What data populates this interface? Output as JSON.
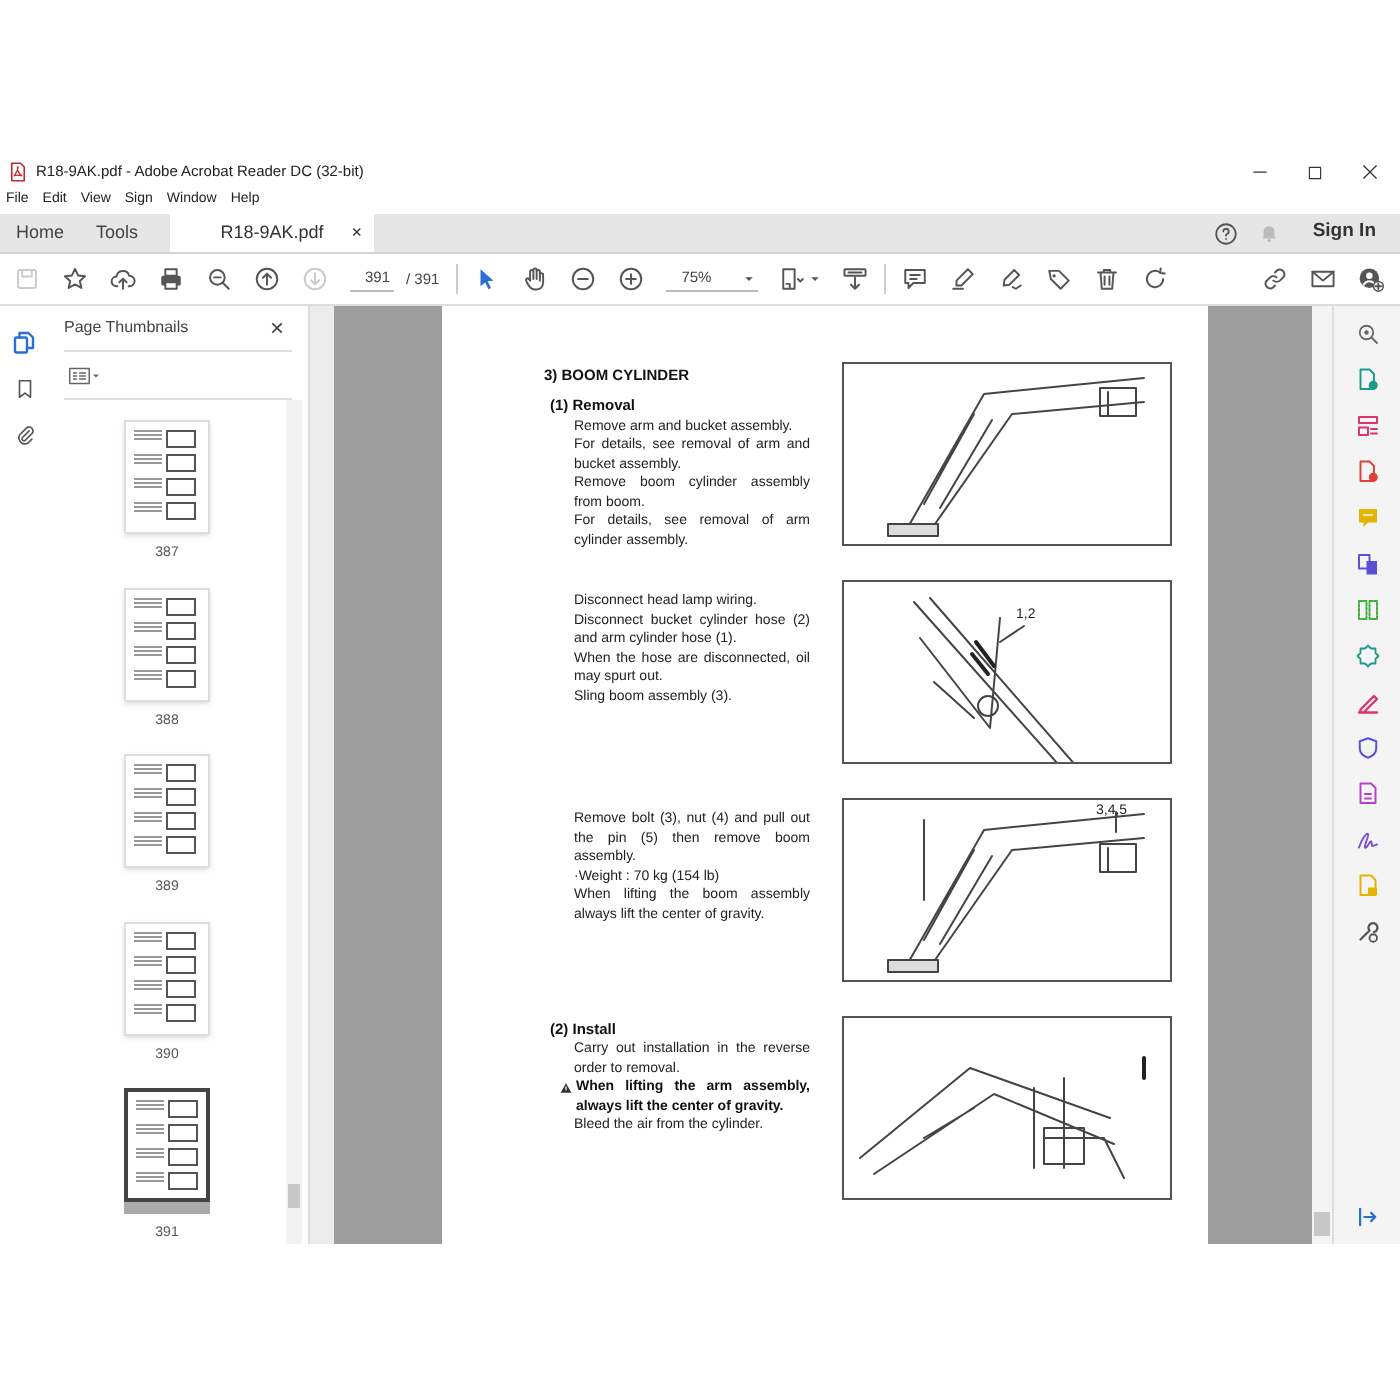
{
  "window": {
    "title": "R18-9AK.pdf - Adobe Acrobat Reader DC (32-bit)"
  },
  "menu": [
    "File",
    "Edit",
    "View",
    "Sign",
    "Window",
    "Help"
  ],
  "tabs": [
    {
      "label": "Home",
      "selected": false
    },
    {
      "label": "Tools",
      "selected": false
    },
    {
      "label": "R18-9AK.pdf",
      "selected": true,
      "close": "×"
    }
  ],
  "account": {
    "sign_in": "Sign In"
  },
  "toolbar": {
    "groups": [
      [
        {
          "kind": "save",
          "disabled": true
        },
        {
          "kind": "star",
          "disabled": false
        },
        {
          "kind": "upload",
          "disabled": false
        },
        {
          "kind": "print",
          "disabled": false
        },
        {
          "kind": "zoomglass",
          "disabled": false
        },
        {
          "kind": "up",
          "disabled": false
        },
        {
          "kind": "down",
          "disabled": true
        },
        {
          "kind": "page",
          "value": "391",
          "total": "/ 391",
          "disabled": false
        }
      ],
      [
        {
          "kind": "pointer",
          "disabled": false
        },
        {
          "kind": "hand",
          "disabled": false
        },
        {
          "kind": "minus",
          "disabled": false
        },
        {
          "kind": "plus",
          "disabled": false
        },
        {
          "kind": "zoom",
          "value": "75%",
          "disabled": false
        },
        {
          "kind": "fit",
          "disabled": false
        },
        {
          "kind": "scroll",
          "disabled": false
        }
      ],
      [
        {
          "kind": "comment",
          "disabled": false
        },
        {
          "kind": "highlight",
          "disabled": false
        },
        {
          "kind": "sign",
          "disabled": false
        },
        {
          "kind": "stamp",
          "disabled": false
        },
        {
          "kind": "trash",
          "disabled": false
        },
        {
          "kind": "redo",
          "disabled": false
        }
      ]
    ],
    "right": [
      {
        "kind": "link",
        "disabled": false
      },
      {
        "kind": "mail",
        "disabled": false
      },
      {
        "kind": "adduser",
        "disabled": false
      }
    ]
  },
  "thumbnails_panel": {
    "title": "Page Thumbnails",
    "close": "×",
    "pages": [
      {
        "label": "387",
        "selected": false
      },
      {
        "label": "388",
        "selected": false
      },
      {
        "label": "389",
        "selected": false
      },
      {
        "label": "390",
        "selected": false
      },
      {
        "label": "391",
        "selected": true
      }
    ]
  },
  "document": {
    "rows": [
      {
        "heading": "3) BOOM CYLINDER",
        "subheading": "(1) Removal",
        "items": [
          {
            "kind": "text",
            "text": "Remove arm and bucket assembly."
          },
          {
            "kind": "text",
            "text": "For details, see removal of arm and bucket assembly."
          },
          {
            "kind": "text",
            "text": "Remove boom cylinder assembly from boom."
          },
          {
            "kind": "text",
            "text": "For details, see removal of arm cylinder assembly."
          }
        ],
        "figure": {
          "kind": "boom"
        }
      },
      {
        "items": [
          {
            "kind": "text",
            "text": "Disconnect head lamp wiring."
          },
          {
            "kind": "text",
            "text": "Disconnect bucket cylinder hose (2) and arm cylinder hose (1)."
          },
          {
            "kind": "text",
            "text": "When the hose are disconnected, oil may spurt out."
          },
          {
            "kind": "text",
            "text": "Sling boom assembly (3)."
          }
        ],
        "figure": {
          "kind": "hose",
          "callout": "1,2"
        }
      },
      {
        "items": [
          {
            "kind": "text",
            "text": "Remove bolt (3), nut (4) and pull out the pin (5) then remove boom assembly."
          },
          {
            "kind": "text",
            "text": "·Weight : 70 kg (154 lb)"
          },
          {
            "kind": "text",
            "text": "When lifting the boom assembly always lift the center of gravity."
          }
        ],
        "figure": {
          "kind": "lift",
          "callout": "3,4,5"
        }
      },
      {
        "subheading": "(2) Install",
        "items": [
          {
            "kind": "text",
            "text": "Carry out installation in the reverse order to removal."
          },
          {
            "kind": "warning",
            "text": "When lifting the arm assembly, always lift the center of gravity."
          },
          {
            "kind": "text",
            "text": "Bleed the air from the cylinder."
          }
        ],
        "figure": {
          "kind": "assembly"
        }
      }
    ]
  }
}
